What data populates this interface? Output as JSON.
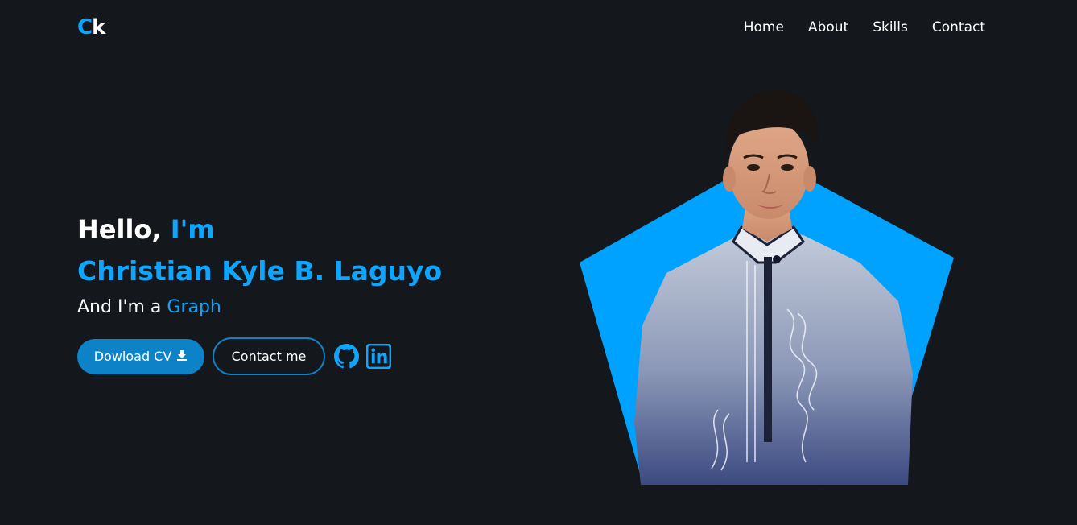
{
  "header": {
    "logo": {
      "first": "C",
      "second": "k"
    },
    "nav": [
      "Home",
      "About",
      "Skills",
      "Contact"
    ]
  },
  "hero": {
    "greeting": "Hello, ",
    "greeting_accent": "I'm",
    "name": "Christian Kyle B. Laguyo",
    "role_prefix": "And I'm a ",
    "role_accent": "Graph",
    "buttons": {
      "download": "Dowload CV",
      "contact": "Contact me"
    },
    "social_icons": [
      "github-icon",
      "linkedin-icon"
    ],
    "image_icon": "profile-photo"
  },
  "colors": {
    "background": "#14171b",
    "accent": "#0ea5ff",
    "button": "#0d82c6",
    "pentagon": "#00a2ff"
  }
}
